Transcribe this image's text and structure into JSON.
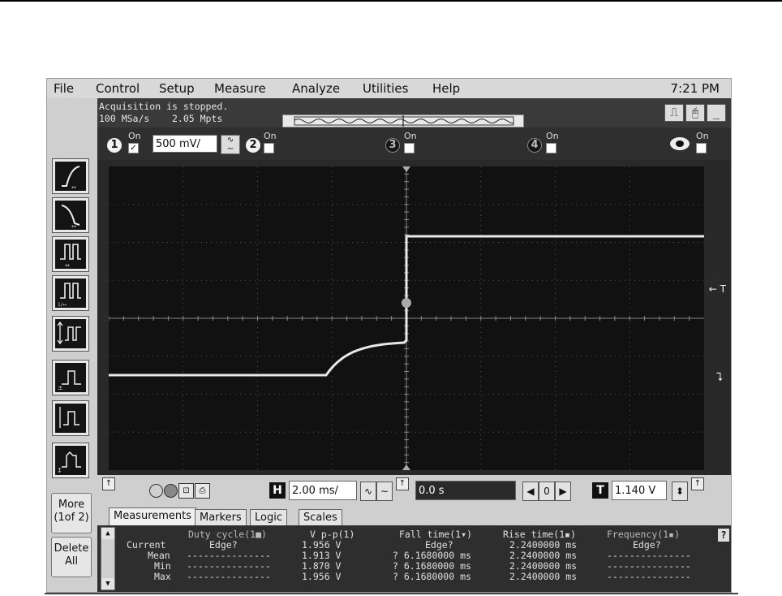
{
  "menu": {
    "items": [
      "File",
      "Control",
      "Setup",
      "Measure",
      "Analyze",
      "Utilities",
      "Help"
    ],
    "clock": "7:21 PM"
  },
  "status": {
    "line1": "Acquisition is stopped.",
    "line2": "100 MSa/s    2.05 Mpts"
  },
  "channels": {
    "on_label": "On",
    "ch1_number": "1",
    "ch1_scale": "500 mV/",
    "ch2_number": "2",
    "ch3_number": "3",
    "ch4_number": "4"
  },
  "side": {
    "more_label": "More\n(1of 2)",
    "delete_label": "Delete\nAll"
  },
  "screen": {
    "trigger_marker": "← T"
  },
  "horizontal": {
    "h_badge": "H",
    "scale": "2.00 ms/",
    "position": "0.0 s",
    "t_badge": "T",
    "trigger_level": "1.140 V"
  },
  "tabs": [
    "Measurements",
    "Markers",
    "Logic",
    "Scales"
  ],
  "measurements": {
    "row_labels": [
      "Current",
      "Mean",
      "Min",
      "Max"
    ],
    "columns": [
      {
        "header": "Duty cycle(1■)",
        "values": [
          "Edge?",
          "---------------",
          "---------------",
          "---------------"
        ]
      },
      {
        "header": "V p-p(1)",
        "values": [
          "1.956 V",
          "1.913 V",
          "1.870 V",
          "1.956 V"
        ]
      },
      {
        "header": "Fall time(1▾)",
        "values": [
          "Edge?",
          "? 6.1680000 ms",
          "? 6.1680000 ms",
          "? 6.1680000 ms"
        ]
      },
      {
        "header": "Rise time(1▪)",
        "values": [
          "2.2400000 ms",
          "2.2400000 ms",
          "2.2400000 ms",
          "2.2400000 ms"
        ]
      },
      {
        "header": "Frequency(1▪)",
        "values": [
          "Edge?",
          "---------------",
          "---------------",
          "---------------"
        ]
      }
    ],
    "help": "?"
  },
  "colors": {
    "trace": "#e8e8e8",
    "graticule_bg": "#111111",
    "panel_bg": "#d8d8d8"
  }
}
